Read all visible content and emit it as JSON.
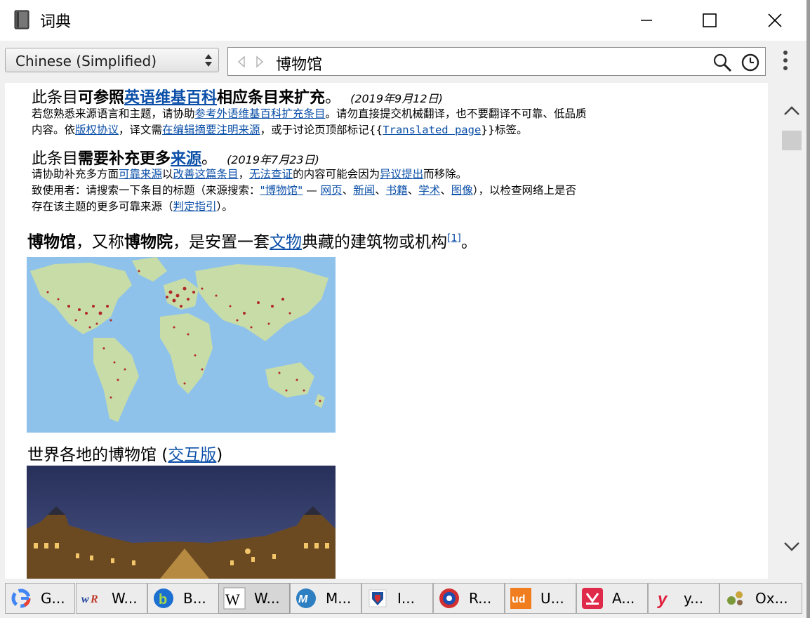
{
  "window": {
    "title": "词典"
  },
  "toolbar": {
    "language": "Chinese (Simplified)",
    "search_value": "博物馆"
  },
  "article": {
    "notice1": {
      "pre": "此条目",
      "bold1": "可参照",
      "link1": "英语维基百科",
      "bold2": "相应条目来扩充",
      "end": "。",
      "date": "(2019年9月12日)",
      "l1a": "若您熟悉来源语言和主题，请协助",
      "l1link": "参考外语维基百科扩充条目",
      "l1b": "。请勿直接提交机械翻译，也不要翻译不可靠、低品质",
      "l2a": "内容。依",
      "l2link1": "版权协议",
      "l2b": "，译文需",
      "l2link2": "在编辑摘要注明来源",
      "l2c": "，或于讨论页顶部标记{{",
      "l2link3": "Translated page",
      "l2d": "}}标签。"
    },
    "notice2": {
      "pre": "此条目",
      "bold1": "需要补充更多",
      "link1": "来源",
      "end": "。",
      "date": "(2019年7月23日)",
      "l1a": "请协助补充多方面",
      "l1link1": "可靠来源",
      "l1b": "以",
      "l1link2": "改善这篇条目",
      "l1c": "，",
      "l1link3": "无法查证",
      "l1d": "的内容可能会因为",
      "l1link4": "异议提出",
      "l1e": "而移除。",
      "l2a": "致使用者：请搜索一下条目的标题（来源搜索：",
      "l2link1": "\"博物馆\"",
      "l2b": "— ",
      "l2link2": "网页",
      "l2sep": "、",
      "l2link3": "新闻",
      "l2link4": "书籍",
      "l2link5": "学术",
      "l2link6": "图像",
      "l2c": "），以检查网络上是否",
      "l3a": "存在该主题的更多可靠来源（",
      "l3link": "判定指引",
      "l3b": "）。"
    },
    "lead": {
      "bold1": "博物馆",
      "t1": "，又称",
      "bold2": "博物院",
      "t2": "，是安置一套",
      "link": "文物",
      "t3": "典藏的建筑物或机构",
      "ref": "[1]",
      "t4": "。"
    },
    "caption": {
      "text": "世界各地的博物馆 (",
      "link": "交互版",
      "end": ")"
    }
  },
  "taskbar": {
    "tabs": [
      {
        "label": "G...",
        "icon": "google-icon"
      },
      {
        "label": "W...",
        "icon": "wordreference-icon"
      },
      {
        "label": "B...",
        "icon": "bing-icon"
      },
      {
        "label": "W...",
        "icon": "wikipedia-icon"
      },
      {
        "label": "M...",
        "icon": "merriam-webster-icon"
      },
      {
        "label": "I...",
        "icon": "i-icon"
      },
      {
        "label": "R...",
        "icon": "r-icon"
      },
      {
        "label": "U...",
        "icon": "urban-dictionary-icon"
      },
      {
        "label": "A...",
        "icon": "a-icon"
      },
      {
        "label": "y...",
        "icon": "y-icon"
      },
      {
        "label": "Ox...",
        "icon": "oxford-icon"
      }
    ]
  },
  "colors": {
    "link": "#0b4fa8",
    "map_water": "#8ec2ea",
    "map_land": "#c8dca8",
    "map_dots": "#b0282a"
  }
}
